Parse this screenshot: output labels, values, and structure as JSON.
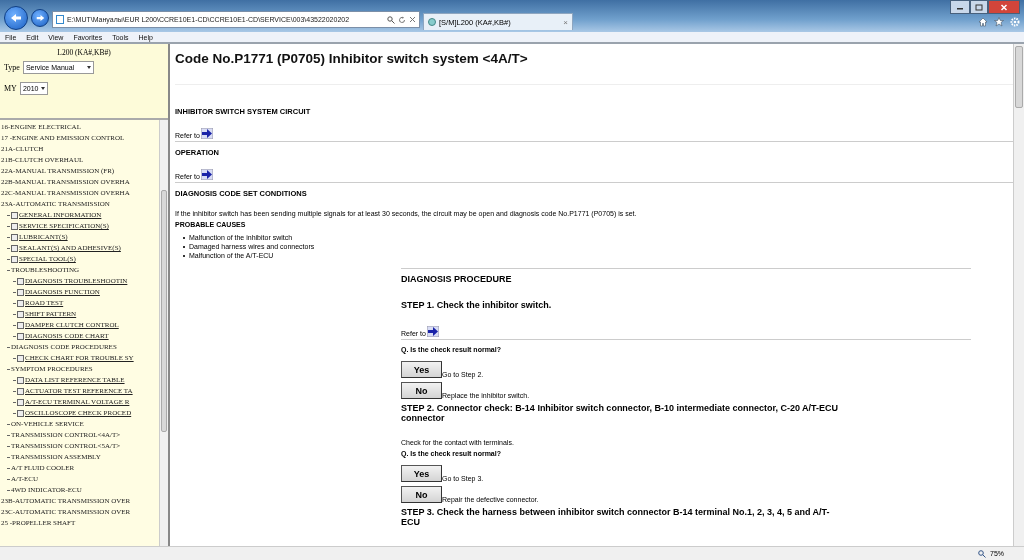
{
  "browser": {
    "address": "E:\\MUT\\Мануалы\\EUR L200\\CCRE10E1-CD\\CCRE10E1-CD\\SERVICE\\003\\43522020202",
    "tab_title": "[S/M]L200 (KA#,KB#)",
    "tab_close": "×",
    "menu": [
      "File",
      "Edit",
      "View",
      "Favorites",
      "Tools",
      "Help"
    ],
    "zoom": "75%"
  },
  "sidebar": {
    "model": "L200 (KA#,KB#)",
    "type_label": "Type",
    "type_value": "Service Manual",
    "my_label": "MY",
    "my_value": "2010",
    "tree": [
      {
        "label": "16-ENGINE ELECTRICAL",
        "kind": "section"
      },
      {
        "label": "17 -ENGINE AND EMISSION CONTROL",
        "kind": "section"
      },
      {
        "label": "21A-CLUTCH",
        "kind": "section"
      },
      {
        "label": "21B-CLUTCH OVERHAUL",
        "kind": "section"
      },
      {
        "label": "22A-MANUAL TRANSMISSION (FR)",
        "kind": "section"
      },
      {
        "label": "22B-MANUAL TRANSMISSION OVERHA",
        "kind": "section"
      },
      {
        "label": "22C-MANUAL TRANSMISSION OVERHA",
        "kind": "section"
      },
      {
        "label": "23A-AUTOMATIC TRANSMISSION",
        "kind": "section",
        "children": [
          {
            "label": "GENERAL INFORMATION",
            "kind": "page"
          },
          {
            "label": "SERVICE SPECIFICATION(S)",
            "kind": "page"
          },
          {
            "label": "LUBRICANT(S)",
            "kind": "page"
          },
          {
            "label": "SEALANT(S) AND ADHESIVE(S)",
            "kind": "page"
          },
          {
            "label": "SPECIAL TOOL(S)",
            "kind": "page"
          },
          {
            "label": "TROUBLESHOOTING",
            "kind": "folder",
            "children": [
              {
                "label": "DIAGNOSIS TROUBLESHOOTIN",
                "kind": "page"
              },
              {
                "label": "DIAGNOSIS FUNCTION",
                "kind": "page"
              },
              {
                "label": "ROAD TEST",
                "kind": "page"
              },
              {
                "label": "SHIFT PATTERN",
                "kind": "page"
              },
              {
                "label": "DAMPER CLUTCH CONTROL",
                "kind": "page"
              },
              {
                "label": "DIAGNOSIS CODE CHART",
                "kind": "page"
              }
            ]
          },
          {
            "label": "DIAGNOSIS CODE PROCEDURES",
            "kind": "folder",
            "children": [
              {
                "label": "CHECK CHART FOR TROUBLE SY",
                "kind": "page"
              }
            ]
          },
          {
            "label": "SYMPTOM PROCEDURES",
            "kind": "folder",
            "children": [
              {
                "label": "DATA LIST REFERENCE TABLE",
                "kind": "page"
              },
              {
                "label": "ACTUATOR TEST REFERENCE TA",
                "kind": "page"
              },
              {
                "label": "A/T-ECU TERMINAL VOLTAGE R",
                "kind": "page"
              },
              {
                "label": "OSCILLOSCOPE CHECK PROCED",
                "kind": "page"
              }
            ]
          },
          {
            "label": "ON-VEHICLE SERVICE",
            "kind": "folder"
          },
          {
            "label": "TRANSMISSION CONTROL<4A/T>",
            "kind": "folder"
          },
          {
            "label": "TRANSMISSION CONTROL<5A/T>",
            "kind": "folder"
          },
          {
            "label": "TRANSMISSION ASSEMBLY",
            "kind": "folder"
          },
          {
            "label": "A/T FLUID COOLER",
            "kind": "folder"
          },
          {
            "label": "A/T-ECU",
            "kind": "folder"
          },
          {
            "label": "4WD INDICATOR-ECU",
            "kind": "folder"
          }
        ]
      },
      {
        "label": "23B-AUTOMATIC TRANSMISSION OVER",
        "kind": "section"
      },
      {
        "label": "23C-AUTOMATIC TRANSMISSION OVER",
        "kind": "section"
      },
      {
        "label": "25 -PROPELLER SHAFT",
        "kind": "section"
      }
    ]
  },
  "content": {
    "title": "Code No.P1771 (P0705) Inhibitor switch system <4A/T>",
    "blocks": [
      {
        "kind": "heading",
        "text": "INHIBITOR SWITCH SYSTEM CIRCUIT"
      },
      {
        "kind": "refer",
        "text": "Refer to"
      },
      {
        "kind": "heading",
        "text": "OPERATION"
      },
      {
        "kind": "refer",
        "text": "Refer to"
      },
      {
        "kind": "heading",
        "text": "DIAGNOSIS CODE SET CONDITIONS"
      },
      {
        "kind": "text",
        "text": "If the inhibitor switch has been sending multiple signals for at least 30 seconds, the circuit may be open and diagnosis code No.P1771 (P0705) is set."
      },
      {
        "kind": "subheading",
        "text": "PROBABLE CAUSES"
      },
      {
        "kind": "bullets",
        "items": [
          "Malfunction of the inhibitor switch",
          "Damaged harness wires and connectors",
          "Malfunction of the A/T-ECU"
        ]
      }
    ],
    "procedure": {
      "title": "DIAGNOSIS PROCEDURE",
      "blocks": [
        {
          "kind": "step",
          "text": "STEP 1. Check the inhibitor switch."
        },
        {
          "kind": "refer",
          "text": "Refer to"
        },
        {
          "kind": "question",
          "text": "Q. Is the check result normal?"
        },
        {
          "kind": "answer",
          "button": "Yes",
          "text": "Go to Step 2."
        },
        {
          "kind": "answer",
          "button": "No",
          "text": "Replace the inhibitor switch."
        },
        {
          "kind": "step",
          "text": "STEP 2. Connector check: B-14 Inhibitor switch connector, B-10 intermediate connector, C-20 A/T-ECU connector"
        },
        {
          "kind": "text",
          "text": "Check for the contact with terminals."
        },
        {
          "kind": "question",
          "text": "Q. Is the check result normal?"
        },
        {
          "kind": "answer",
          "button": "Yes",
          "text": "Go to Step 3."
        },
        {
          "kind": "answer",
          "button": "No",
          "text": "Repair the defective connector."
        },
        {
          "kind": "step",
          "text": "STEP 3. Check the harness between inhibitor switch connector B-14 terminal No.1, 2, 3, 4, 5 and A/T-ECU"
        }
      ]
    }
  }
}
